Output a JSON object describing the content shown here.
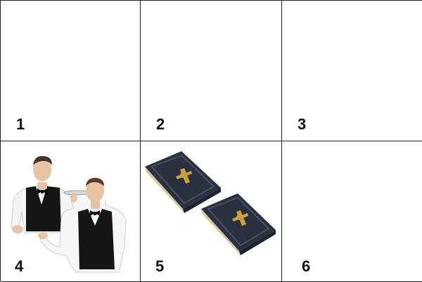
{
  "cells": [
    {
      "number": "1",
      "picture": "empty"
    },
    {
      "number": "2",
      "picture": "empty"
    },
    {
      "number": "3",
      "picture": "empty"
    },
    {
      "number": "4",
      "picture": "two-waiters-image"
    },
    {
      "number": "5",
      "picture": "two-books-image"
    },
    {
      "number": "6",
      "picture": "empty"
    }
  ],
  "colors": {
    "grid_line": "#222222",
    "number_text": "#111111",
    "book_cover": "#2b3040",
    "book_gold": "#c9a23a",
    "vest": "#151515"
  }
}
